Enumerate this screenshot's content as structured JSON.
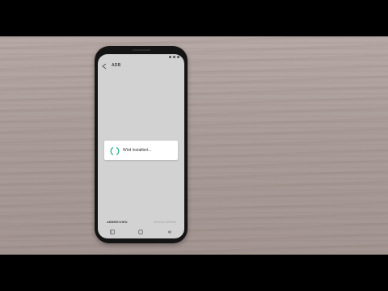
{
  "app": {
    "title": "ADB"
  },
  "dialog": {
    "message": "Wird installiert..."
  },
  "bottom_bar": {
    "left_label": "ABBRECHEN",
    "right_label": "INSTALLIEREN"
  },
  "icons": {
    "back": "back-arrow-icon",
    "spinner": "loading-spinner-icon",
    "nav_recents": "recents-icon",
    "nav_home": "home-icon",
    "nav_back": "back-icon"
  },
  "colors": {
    "spinner_accent": "#1fa88a",
    "screen_background": "#d2d2d2",
    "dialog_background": "#ffffff"
  }
}
